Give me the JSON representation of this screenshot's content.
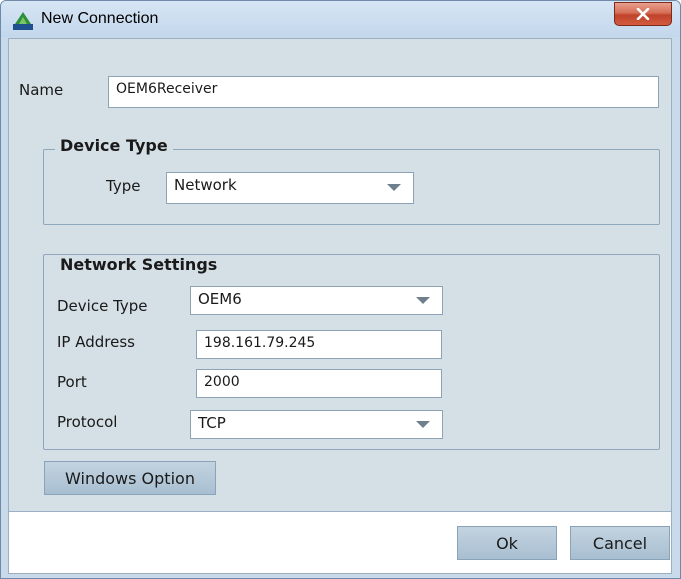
{
  "window": {
    "title": "New Connection",
    "close_icon": "close-icon"
  },
  "name_field": {
    "label": "Name",
    "value": "OEM6Receiver"
  },
  "device_type_group": {
    "title": "Device Type",
    "type_label": "Type",
    "type_value": "Network"
  },
  "network_settings": {
    "title": "Network Settings",
    "device_type_label": "Device Type",
    "device_type_value": "OEM6",
    "ip_label": "IP Address",
    "ip_value": "198.161.79.245",
    "port_label": "Port",
    "port_value": "2000",
    "protocol_label": "Protocol",
    "protocol_value": "TCP"
  },
  "buttons": {
    "windows_option": "Windows Option",
    "ok": "Ok",
    "cancel": "Cancel"
  },
  "colors": {
    "titlebar": "#c3d7ec",
    "client": "#d5dfe6",
    "close": "#c0422a",
    "button": "#a8bfd1"
  }
}
